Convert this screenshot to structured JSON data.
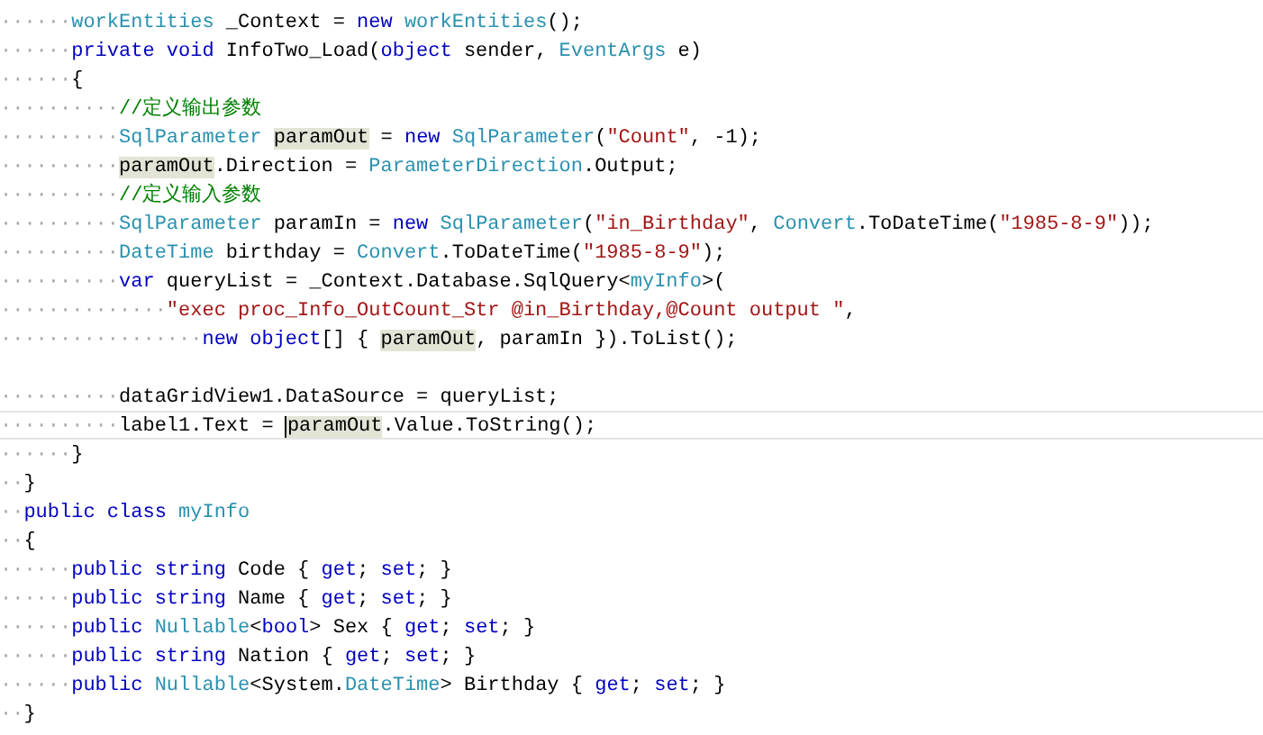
{
  "editor": {
    "lines": [
      {
        "kind": "code",
        "indent": "······",
        "tokens": [
          {
            "kind": "type",
            "text": "workEntities"
          },
          {
            "kind": "plain",
            "text": " _Context = "
          },
          {
            "kind": "keyword",
            "text": "new "
          },
          {
            "kind": "type",
            "text": "workEntities"
          },
          {
            "kind": "plain",
            "text": "();"
          }
        ]
      },
      {
        "kind": "code",
        "indent": "······",
        "tokens": [
          {
            "kind": "keyword",
            "text": "private void"
          },
          {
            "kind": "plain",
            "text": " InfoTwo_Load("
          },
          {
            "kind": "keyword",
            "text": "object"
          },
          {
            "kind": "plain",
            "text": " sender, "
          },
          {
            "kind": "type",
            "text": "EventArgs"
          },
          {
            "kind": "plain",
            "text": " e)"
          }
        ]
      },
      {
        "kind": "code",
        "indent": "······",
        "tokens": [
          {
            "kind": "plain",
            "text": "{"
          }
        ]
      },
      {
        "kind": "code",
        "indent": "··········",
        "tokens": [
          {
            "kind": "comment",
            "text": "//定义输出参数"
          }
        ]
      },
      {
        "kind": "code",
        "indent": "··········",
        "tokens": [
          {
            "kind": "type",
            "text": "SqlParameter "
          },
          {
            "kind": "plain",
            "text": "paramOut",
            "highlighted": true
          },
          {
            "kind": "plain",
            "text": " = "
          },
          {
            "kind": "keyword",
            "text": "new "
          },
          {
            "kind": "type",
            "text": "SqlParameter"
          },
          {
            "kind": "plain",
            "text": "("
          },
          {
            "kind": "string",
            "text": "\"Count\""
          },
          {
            "kind": "plain",
            "text": ", -1);"
          }
        ]
      },
      {
        "kind": "code",
        "indent": "··········",
        "tokens": [
          {
            "kind": "plain",
            "text": "paramOut",
            "highlighted": true
          },
          {
            "kind": "plain",
            "text": ".Direction = "
          },
          {
            "kind": "type",
            "text": "ParameterDirection"
          },
          {
            "kind": "plain",
            "text": ".Output;"
          }
        ]
      },
      {
        "kind": "code",
        "indent": "··········",
        "tokens": [
          {
            "kind": "comment",
            "text": "//定义输入参数"
          }
        ]
      },
      {
        "kind": "code",
        "indent": "··········",
        "tokens": [
          {
            "kind": "type",
            "text": "SqlParameter"
          },
          {
            "kind": "plain",
            "text": " paramIn = "
          },
          {
            "kind": "keyword",
            "text": "new "
          },
          {
            "kind": "type",
            "text": "SqlParameter"
          },
          {
            "kind": "plain",
            "text": "("
          },
          {
            "kind": "string",
            "text": "\"in_Birthday\""
          },
          {
            "kind": "plain",
            "text": ", "
          },
          {
            "kind": "type",
            "text": "Convert"
          },
          {
            "kind": "plain",
            "text": ".ToDateTime("
          },
          {
            "kind": "string",
            "text": "\"1985-8-9\""
          },
          {
            "kind": "plain",
            "text": "));"
          }
        ]
      },
      {
        "kind": "code",
        "indent": "··········",
        "tokens": [
          {
            "kind": "type",
            "text": "DateTime"
          },
          {
            "kind": "plain",
            "text": " birthday = "
          },
          {
            "kind": "type",
            "text": "Convert"
          },
          {
            "kind": "plain",
            "text": ".ToDateTime("
          },
          {
            "kind": "string",
            "text": "\"1985-8-9\""
          },
          {
            "kind": "plain",
            "text": ");"
          }
        ]
      },
      {
        "kind": "code",
        "indent": "··········",
        "tokens": [
          {
            "kind": "keyword",
            "text": "var"
          },
          {
            "kind": "plain",
            "text": " queryList = _Context.Database.SqlQuery<"
          },
          {
            "kind": "type",
            "text": "myInfo"
          },
          {
            "kind": "plain",
            "text": ">("
          }
        ]
      },
      {
        "kind": "code",
        "indent": "··············",
        "tokens": [
          {
            "kind": "string",
            "text": "\"exec proc_Info_OutCount_Str @in_Birthday,@Count output \""
          },
          {
            "kind": "plain",
            "text": ","
          }
        ]
      },
      {
        "kind": "code",
        "indent": "·················",
        "tokens": [
          {
            "kind": "keyword",
            "text": "new object"
          },
          {
            "kind": "plain",
            "text": "[] { "
          },
          {
            "kind": "plain",
            "text": "paramOut",
            "highlighted": true
          },
          {
            "kind": "plain",
            "text": ", paramIn }).ToList();"
          }
        ]
      },
      {
        "kind": "blank"
      },
      {
        "kind": "code",
        "indent": "··········",
        "tokens": [
          {
            "kind": "plain",
            "text": "dataGridView1.DataSource = queryList;"
          }
        ]
      },
      {
        "kind": "code",
        "indent": "··········",
        "current": true,
        "tokens": [
          {
            "kind": "plain",
            "text": "label1.Text = "
          },
          {
            "kind": "plain",
            "text": "paramOut",
            "highlighted": true,
            "caret": true
          },
          {
            "kind": "plain",
            "text": ".Value.ToString();"
          }
        ]
      },
      {
        "kind": "code",
        "indent": "······",
        "tokens": [
          {
            "kind": "plain",
            "text": "}"
          }
        ]
      },
      {
        "kind": "code",
        "indent": "··",
        "tokens": [
          {
            "kind": "plain",
            "text": "}"
          }
        ]
      },
      {
        "kind": "code",
        "indent": "··",
        "tokens": [
          {
            "kind": "keyword",
            "text": "public class "
          },
          {
            "kind": "type",
            "text": "myInfo"
          }
        ]
      },
      {
        "kind": "code",
        "indent": "··",
        "tokens": [
          {
            "kind": "plain",
            "text": "{"
          }
        ]
      },
      {
        "kind": "code",
        "indent": "······",
        "tokens": [
          {
            "kind": "keyword",
            "text": "public string"
          },
          {
            "kind": "plain",
            "text": " Code { "
          },
          {
            "kind": "keyword",
            "text": "get"
          },
          {
            "kind": "plain",
            "text": "; "
          },
          {
            "kind": "keyword",
            "text": "set"
          },
          {
            "kind": "plain",
            "text": "; }"
          }
        ]
      },
      {
        "kind": "code",
        "indent": "······",
        "tokens": [
          {
            "kind": "keyword",
            "text": "public string"
          },
          {
            "kind": "plain",
            "text": " Name { "
          },
          {
            "kind": "keyword",
            "text": "get"
          },
          {
            "kind": "plain",
            "text": "; "
          },
          {
            "kind": "keyword",
            "text": "set"
          },
          {
            "kind": "plain",
            "text": "; }"
          }
        ]
      },
      {
        "kind": "code",
        "indent": "······",
        "tokens": [
          {
            "kind": "keyword",
            "text": "public "
          },
          {
            "kind": "type",
            "text": "Nullable"
          },
          {
            "kind": "plain",
            "text": "<"
          },
          {
            "kind": "keyword",
            "text": "bool"
          },
          {
            "kind": "plain",
            "text": "> Sex { "
          },
          {
            "kind": "keyword",
            "text": "get"
          },
          {
            "kind": "plain",
            "text": "; "
          },
          {
            "kind": "keyword",
            "text": "set"
          },
          {
            "kind": "plain",
            "text": "; }"
          }
        ]
      },
      {
        "kind": "code",
        "indent": "······",
        "tokens": [
          {
            "kind": "keyword",
            "text": "public string"
          },
          {
            "kind": "plain",
            "text": " Nation { "
          },
          {
            "kind": "keyword",
            "text": "get"
          },
          {
            "kind": "plain",
            "text": "; "
          },
          {
            "kind": "keyword",
            "text": "set"
          },
          {
            "kind": "plain",
            "text": "; }"
          }
        ]
      },
      {
        "kind": "code",
        "indent": "······",
        "tokens": [
          {
            "kind": "keyword",
            "text": "public "
          },
          {
            "kind": "type",
            "text": "Nullable"
          },
          {
            "kind": "plain",
            "text": "<System."
          },
          {
            "kind": "type",
            "text": "DateTime"
          },
          {
            "kind": "plain",
            "text": "> Birthday { "
          },
          {
            "kind": "keyword",
            "text": "get"
          },
          {
            "kind": "plain",
            "text": "; "
          },
          {
            "kind": "keyword",
            "text": "set"
          },
          {
            "kind": "plain",
            "text": "; }"
          }
        ]
      },
      {
        "kind": "code",
        "indent": "··",
        "tokens": [
          {
            "kind": "plain",
            "text": "}"
          }
        ]
      }
    ]
  }
}
